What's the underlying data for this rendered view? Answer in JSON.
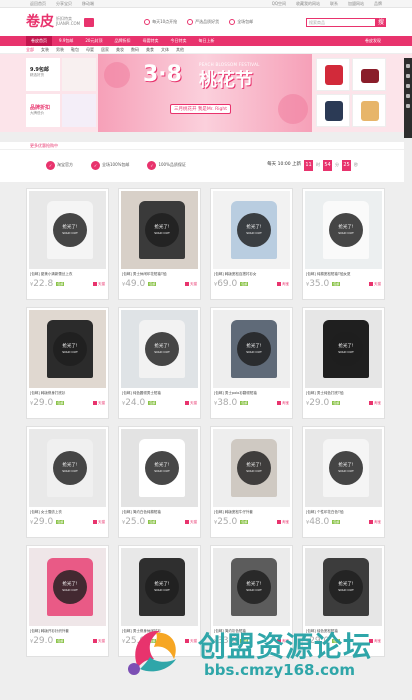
{
  "topbar": {
    "items": [
      "返回首页",
      "分享宝贝",
      "移动端"
    ],
    "right": [
      "QQ空间",
      "收藏我的网站",
      "联系",
      "加盟网站",
      "品牌"
    ]
  },
  "logo": {
    "title": "卷皮",
    "sub": "折扣特卖",
    "sub2": "JUANPI.COM"
  },
  "features": [
    {
      "label": "每天10点开抢"
    },
    {
      "label": "严选品质好货"
    },
    {
      "label": "全场包邮"
    }
  ],
  "search": {
    "placeholder": "搜索商品",
    "button": "搜"
  },
  "nav": {
    "items": [
      "卷皮首页",
      "9.9包邮",
      "20元封顶",
      "品牌折扣",
      "母婴特卖",
      "今日特卖",
      "每日上新"
    ],
    "right": "卷皮发现",
    "active": 0
  },
  "categories": [
    "全部",
    "女装",
    "男装",
    "鞋包",
    "母婴",
    "居家",
    "美妆",
    "数码",
    "美食",
    "文体",
    "其他"
  ],
  "banner": {
    "left_title": "9.9包邮",
    "left_sub": "精选好货",
    "left_title2": "品牌折扣",
    "left_sub2": "大牌低价",
    "num": "3·8",
    "en": "PEACH BLOSSOM FESTIVAL",
    "zh": "桃花节",
    "pill": "三月桃花开 我是Mr. Right"
  },
  "section": {
    "tip": "更多优惠抢购中",
    "f1": "淘宝官方",
    "f2": "全场100%包邮",
    "f3": "100%品质保证",
    "countdown_label": "每天 10:00 上新",
    "cd1": "11",
    "cd2": "54",
    "cd3": "25",
    "unit_h": "时",
    "unit_m": "分",
    "unit_s": "秒"
  },
  "sold": {
    "a": "抢光了!",
    "b": "SOLD OUT"
  },
  "products": [
    {
      "name": "[包邮] 甜美小清新蕾丝上衣",
      "price": "22.8",
      "tag": "包邮",
      "shop": "天猫",
      "color": "#f5f5f5",
      "bg": "#e8e8e8"
    },
    {
      "name": "[包邮] 男士休闲印花短袖T恤",
      "price": "49.0",
      "tag": "包邮",
      "shop": "天猫",
      "color": "#3a3a3a",
      "bg": "#d8d0c8"
    },
    {
      "name": "[包邮] 韩版宽松百搭衬衫女",
      "price": "69.0",
      "tag": "包邮",
      "shop": "淘宝",
      "color": "#b9cde0",
      "bg": "#f2f2f2"
    },
    {
      "name": "[包邮] 纯棉宽松短袖T恤女夏",
      "price": "35.0",
      "tag": "包邮",
      "shop": "天猫",
      "color": "#fafafa",
      "bg": "#eceff0"
    },
    {
      "name": "[包邮] 韩版修身打底衫",
      "price": "29.0",
      "tag": "包邮",
      "shop": "天猫",
      "color": "#2b2b2b",
      "bg": "#e0d8d0"
    },
    {
      "name": "[包邮] 纯色圆领男士短袖",
      "price": "24.0",
      "tag": "包邮",
      "shop": "天猫",
      "color": "#f2f2f2",
      "bg": "#dfe3e6"
    },
    {
      "name": "[包邮] 男士polo衫翻领短袖",
      "price": "38.0",
      "tag": "包邮",
      "shop": "淘宝",
      "color": "#5f6a78",
      "bg": "#eeeeee"
    },
    {
      "name": "[包邮] 男士纯色打底T恤",
      "price": "29.0",
      "tag": "包邮",
      "shop": "淘宝",
      "color": "#1f1f1f",
      "bg": "#e6e6e6"
    },
    {
      "name": "[包邮] 女士雪纺上衣",
      "price": "29.0",
      "tag": "包邮",
      "shop": "天猫",
      "color": "#f0f0f0",
      "bg": "#e9e9e9"
    },
    {
      "name": "[包邮] 简约白色纯棉短袖",
      "price": "25.0",
      "tag": "包邮",
      "shop": "天猫",
      "color": "#ffffff",
      "bg": "#e3e3e3"
    },
    {
      "name": "[包邮] 韩版宽松牛仔外套",
      "price": "25.0",
      "tag": "包邮",
      "shop": "淘宝",
      "color": "#cfc9c2",
      "bg": "#eeeeee"
    },
    {
      "name": "[包邮] 个性印花白色T恤",
      "price": "48.0",
      "tag": "包邮",
      "shop": "淘宝",
      "color": "#f5f5f5",
      "bg": "#e8e8e8"
    },
    {
      "name": "[包邮] 韩版开衫针织外套",
      "price": "29.0",
      "tag": "包邮",
      "shop": "天猫",
      "color": "#e95a86",
      "bg": "#efe6e8"
    },
    {
      "name": "[包邮] 男士修身休闲衬衫",
      "price": "25.0",
      "tag": "包邮",
      "shop": "天猫",
      "color": "#2f2f2f",
      "bg": "#e8e8e8"
    },
    {
      "name": "[包邮] 简约灰色短袖",
      "price": "33.0",
      "tag": "包邮",
      "shop": "淘宝",
      "color": "#5c5c5c",
      "bg": "#ebebeb"
    },
    {
      "name": "[包邮] 纯色宽松短袖",
      "price": "29.0",
      "tag": "包邮",
      "shop": "淘宝",
      "color": "#3c3c3c",
      "bg": "#e6e6e6"
    }
  ],
  "watermark": {
    "title": "创盟资源论坛",
    "url": "bbs.cmzy168.com"
  }
}
